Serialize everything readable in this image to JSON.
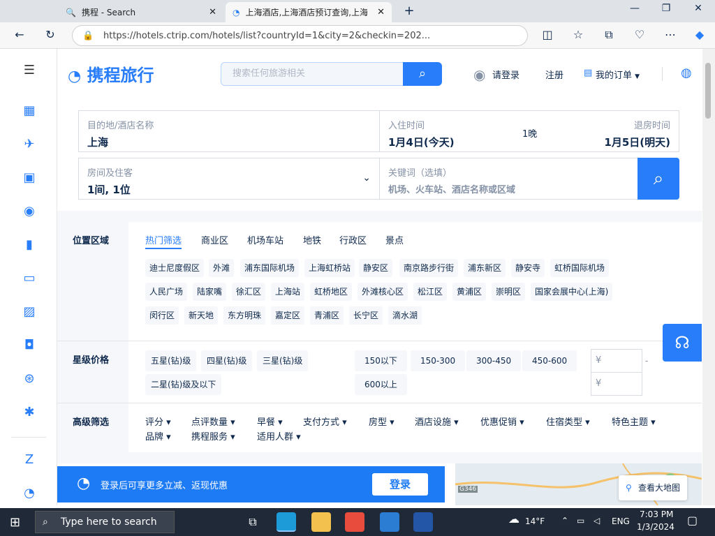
{
  "browser": {
    "tabs": [
      {
        "label": "携程 - Search",
        "active": false
      },
      {
        "label": "上海酒店,上海酒店预订查询,上海",
        "active": true
      }
    ],
    "url": "https://hotels.ctrip.com/hotels/list?countryId=1&city=2&checkin=202..."
  },
  "header": {
    "logo": "携程旅行",
    "search_placeholder": "搜索任何旅游相关",
    "login": "请登录",
    "register": "注册",
    "my_orders": "我的订单"
  },
  "search_panel": {
    "dest_label": "目的地/酒店名称",
    "dest_value": "上海",
    "checkin_label": "入住时间",
    "checkin_value": "1月4日(今天)",
    "nights": "1晚",
    "checkout_label": "退房时间",
    "checkout_value": "1月5日(明天)",
    "rooms_label": "房间及住客",
    "rooms_value": "1间, 1位",
    "keyword_label": "关键词（选填）",
    "keyword_placeholder": "机场、火车站、酒店名称或区域"
  },
  "location": {
    "heading": "位置区域",
    "tabs": [
      "热门筛选",
      "商业区",
      "机场车站",
      "地铁",
      "行政区",
      "景点"
    ],
    "active_tab": 0,
    "chips_row1": [
      "迪士尼度假区",
      "外滩",
      "浦东国际机场",
      "上海虹桥站",
      "静安区",
      "南京路步行街",
      "浦东新区",
      "静安寺",
      "虹桥国际机场"
    ],
    "chips_row2": [
      "人民广场",
      "陆家嘴",
      "徐汇区",
      "上海站",
      "虹桥地区",
      "外滩核心区",
      "松江区",
      "黄浦区",
      "崇明区",
      "国家会展中心(上海)"
    ],
    "chips_row3": [
      "闵行区",
      "新天地",
      "东方明珠",
      "嘉定区",
      "青浦区",
      "长宁区",
      "滴水湖"
    ]
  },
  "star_price": {
    "heading": "星级价格",
    "stars": [
      "五星(钻)级",
      "四星(钻)级",
      "三星(钻)级",
      "二星(钻)级及以下"
    ],
    "prices": [
      "150以下",
      "150-300",
      "300-450",
      "450-600",
      "600以上"
    ],
    "currency": "¥",
    "dash": "-"
  },
  "advanced": {
    "heading": "高级筛选",
    "items": [
      "评分",
      "点评数量",
      "早餐",
      "支付方式",
      "房型",
      "酒店设施",
      "优惠促销",
      "住宿类型",
      "特色主题",
      "品牌",
      "携程服务",
      "适用人群"
    ]
  },
  "banner": {
    "text": "登录后可享更多立减、返现优惠",
    "button": "登录"
  },
  "map": {
    "button": "查看大地图",
    "road_label": "G346"
  },
  "taskbar": {
    "search_placeholder": "Type here to search",
    "weather": "14°F",
    "lang": "ENG",
    "time": "7:03 PM",
    "date": "1/3/2024"
  }
}
